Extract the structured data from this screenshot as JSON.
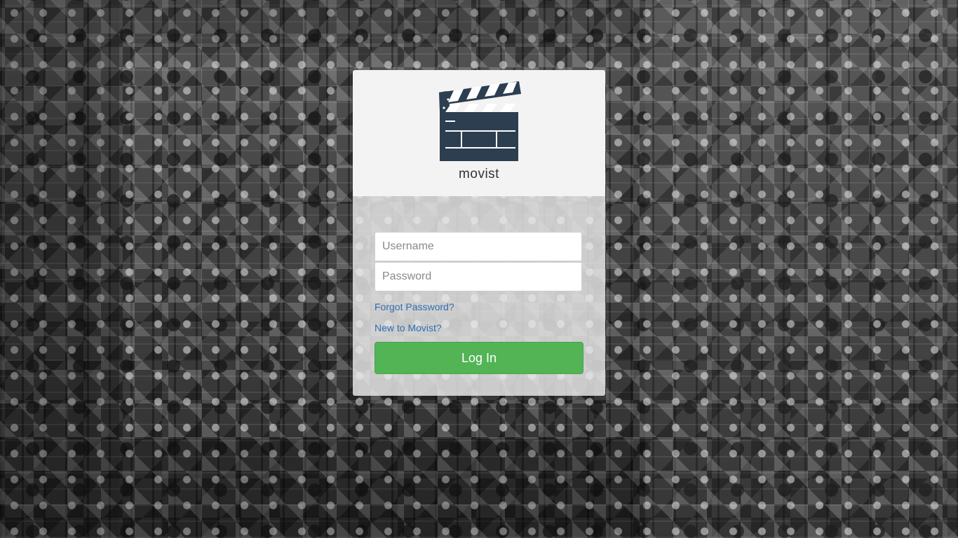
{
  "app": {
    "brand_name": "movist",
    "logo_icon": "clapperboard-icon"
  },
  "login_form": {
    "username_placeholder": "Username",
    "password_placeholder": "Password",
    "username_value": "",
    "password_value": "",
    "forgot_password_link": "Forgot Password?",
    "new_user_link": "New to Movist?",
    "login_button": "Log In"
  },
  "colors": {
    "header_background": "#f3f3f3",
    "logo": "#2c3e50",
    "login_button": "#52b455",
    "link": "#2f6fb2"
  }
}
